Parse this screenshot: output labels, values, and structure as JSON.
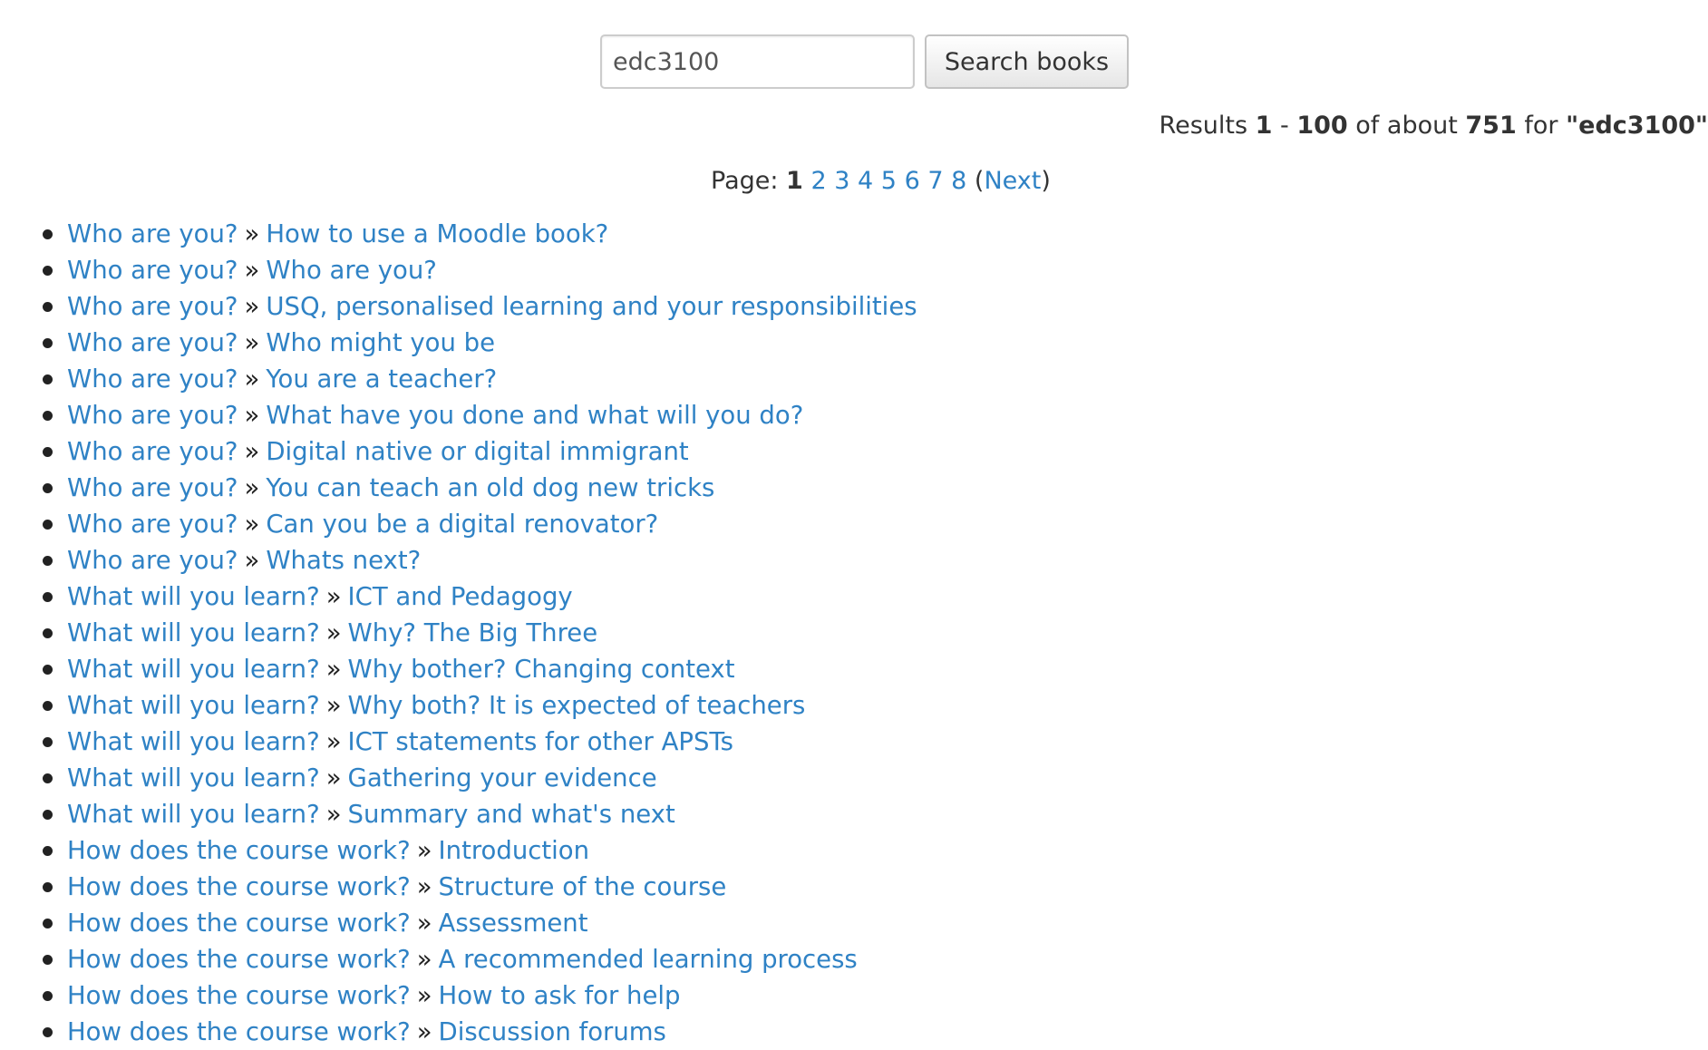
{
  "search": {
    "value": "edc3100",
    "button_label": "Search books"
  },
  "summary": {
    "prefix": "Results ",
    "from": "1",
    "dash": " - ",
    "to": "100",
    "mid": " of about ",
    "total": "751",
    "for": " for ",
    "query": "\"edc3100\""
  },
  "pager": {
    "label": "Page: ",
    "current": "1",
    "pages": [
      "2",
      "3",
      "4",
      "5",
      "6",
      "7",
      "8"
    ],
    "open_paren": "(",
    "next_label": "Next",
    "close_paren": ")"
  },
  "separator": "»",
  "results": [
    {
      "book": "Who are you?",
      "chapter": "How to use a Moodle book?"
    },
    {
      "book": "Who are you?",
      "chapter": "Who are you?"
    },
    {
      "book": "Who are you?",
      "chapter": "USQ, personalised learning and your responsibilities"
    },
    {
      "book": "Who are you?",
      "chapter": "Who might you be"
    },
    {
      "book": "Who are you?",
      "chapter": "You are a teacher?"
    },
    {
      "book": "Who are you?",
      "chapter": "What have you done and what will you do?"
    },
    {
      "book": "Who are you?",
      "chapter": "Digital native or digital immigrant"
    },
    {
      "book": "Who are you?",
      "chapter": "You can teach an old dog new tricks"
    },
    {
      "book": "Who are you?",
      "chapter": "Can you be a digital renovator?"
    },
    {
      "book": "Who are you?",
      "chapter": "Whats next?"
    },
    {
      "book": "What will you learn?",
      "chapter": "ICT and Pedagogy"
    },
    {
      "book": "What will you learn?",
      "chapter": "Why? The Big Three"
    },
    {
      "book": "What will you learn?",
      "chapter": "Why bother? Changing context"
    },
    {
      "book": "What will you learn?",
      "chapter": "Why both? It is expected of teachers"
    },
    {
      "book": "What will you learn?",
      "chapter": "ICT statements for other APSTs"
    },
    {
      "book": "What will you learn?",
      "chapter": "Gathering your evidence"
    },
    {
      "book": "What will you learn?",
      "chapter": "Summary and what's next"
    },
    {
      "book": "How does the course work?",
      "chapter": "Introduction"
    },
    {
      "book": "How does the course work?",
      "chapter": "Structure of the course"
    },
    {
      "book": "How does the course work?",
      "chapter": "Assessment"
    },
    {
      "book": "How does the course work?",
      "chapter": "A recommended learning process"
    },
    {
      "book": "How does the course work?",
      "chapter": "How to ask for help"
    },
    {
      "book": "How does the course work?",
      "chapter": "Discussion forums"
    }
  ]
}
